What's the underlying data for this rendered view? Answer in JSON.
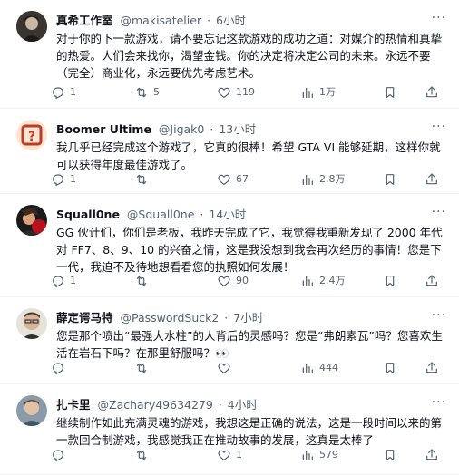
{
  "tweets": [
    {
      "name": "真希工作室",
      "handle": "@makisatelier",
      "time": "6小时",
      "text": "对于你的下一款游戏，请不要忘记这款游戏的成功之道：对媒介的热情和真挚的热爱。人们会来找你，渴望金钱。你的决定将决定公司的未来。永远不要（完全）商业化，永远要优先考虑艺术。",
      "replies": "1",
      "retweets": "5",
      "likes": "119",
      "views": "1万"
    },
    {
      "name": "Boomer Ultime",
      "handle": "@Jigak0",
      "time": "13小时",
      "text": "我几乎已经完成这个游戏了，它真的很棒！希望 GTA VI 能够延期，这样你就可以获得年度最佳游戏了。",
      "replies": "1",
      "retweets": "",
      "likes": "67",
      "views": "2.8万"
    },
    {
      "name": "Squall0ne",
      "handle": "@Squall0ne",
      "time": "14小时",
      "text": "GG 伙计们，你们是老板，我昨天完成了它，我觉得我重新发现了 2000 年代对 FF7、8、9、10 的兴奋之情，这是我没想到我会再次经历的事情！您是下一代，我迫不及待地想看看您的执照如何发展！",
      "replies": "1",
      "retweets": "",
      "likes": "90",
      "views": "2.4万"
    },
    {
      "name": "薛定谔马特",
      "handle": "@PasswordSuck2",
      "time": "7小时",
      "text": "您是那个喷出“最强大水柱”的人背后的灵感吗？您是“弗朗索瓦”吗？您喜欢生活在岩石下吗？在那里舒服吗？👀",
      "replies": "",
      "retweets": "",
      "likes": "",
      "views": "444"
    },
    {
      "name": "扎卡里",
      "handle": "@Zachary49634279",
      "time": "4小时",
      "text": "继续制作如此充满灵魂的游戏，我想这是正确的说法，这是一段时间以来的第一款回合制游戏，我感觉我正在推动故事的发展，这真是太棒了",
      "replies": "",
      "retweets": "",
      "likes": "1",
      "views": "579"
    }
  ],
  "icons": {
    "reply": "reply-icon",
    "retweet": "retweet-icon",
    "like": "heart-icon",
    "views": "views-icon",
    "bookmark": "bookmark-icon",
    "share": "share-icon",
    "more": "more-icon"
  },
  "colors": {
    "text": "#0f1419",
    "secondary": "#536471",
    "divider": "#eff3f4"
  }
}
